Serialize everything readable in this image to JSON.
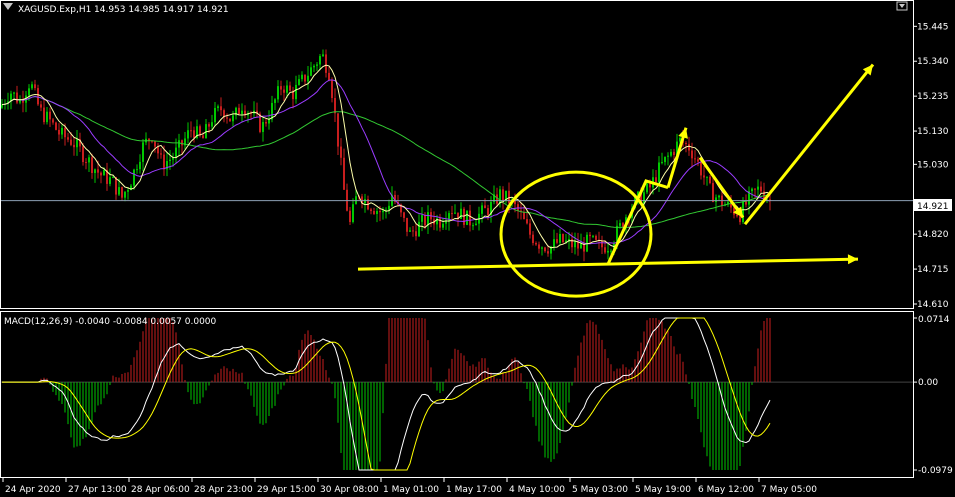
{
  "window": {
    "title": "XAGUSD.Exp,H1",
    "ohlc": "14.953 14.985 14.917 14.921"
  },
  "colors": {
    "background": "#000000",
    "grid_frame": "#ffffff",
    "bull_candle": "#00c800",
    "bear_candle": "#c81e1e",
    "ma_fast": "#ffffaa",
    "ma_mid": "#9a3cff",
    "ma_slow": "#32c832",
    "price_line": "#8da0b4",
    "annotation": "#ffff00",
    "macd_main": "#ffffff",
    "macd_signal": "#ffff00"
  },
  "price_axis": {
    "ticks": [
      "15.445",
      "15.340",
      "15.235",
      "15.130",
      "15.030",
      "14.921",
      "14.820",
      "14.715",
      "14.610"
    ],
    "current": "14.921"
  },
  "macd": {
    "label": "MACD(12,26,9) -0.0040 -0.0084 0.0057 0.0000",
    "ticks": [
      "0.0714",
      "0.00",
      "-0.0979"
    ]
  },
  "time_axis": {
    "ticks": [
      "24 Apr 2020",
      "27 Apr 13:00",
      "28 Apr 06:00",
      "28 Apr 23:00",
      "29 Apr 15:00",
      "30 Apr 08:00",
      "1 May 01:00",
      "1 May 17:00",
      "4 May 10:00",
      "5 May 03:00",
      "5 May 19:00",
      "6 May 12:00",
      "7 May 05:00"
    ]
  },
  "chart_data": [
    {
      "type": "candlestick",
      "symbol": "XAGUSD.Exp",
      "timeframe": "H1",
      "ylim": [
        14.61,
        15.47
      ],
      "indicators": [
        "moving average (fast)",
        "moving average (mid)",
        "moving average (slow)"
      ],
      "annotations": [
        "ellipse around consolidation near 14.78",
        "horizontal support arrow near 14.70",
        "zig-zag projection arrow toward 15.33"
      ],
      "close_path": [
        [
          0,
          15.2
        ],
        [
          10,
          15.25
        ],
        [
          20,
          15.22
        ],
        [
          30,
          15.28
        ],
        [
          40,
          15.19
        ],
        [
          50,
          15.16
        ],
        [
          60,
          15.12
        ],
        [
          72,
          15.1
        ],
        [
          86,
          15.05
        ],
        [
          100,
          15.0
        ],
        [
          112,
          14.98
        ],
        [
          122,
          14.93
        ],
        [
          132,
          14.99
        ],
        [
          142,
          15.08
        ],
        [
          152,
          15.12
        ],
        [
          162,
          15.03
        ],
        [
          172,
          15.05
        ],
        [
          182,
          15.09
        ],
        [
          192,
          15.14
        ],
        [
          202,
          15.1
        ],
        [
          212,
          15.17
        ],
        [
          222,
          15.2
        ],
        [
          232,
          15.16
        ],
        [
          242,
          15.21
        ],
        [
          252,
          15.18
        ],
        [
          262,
          15.14
        ],
        [
          272,
          15.2
        ],
        [
          282,
          15.27
        ],
        [
          292,
          15.24
        ],
        [
          302,
          15.28
        ],
        [
          312,
          15.32
        ],
        [
          322,
          15.36
        ],
        [
          330,
          15.3
        ],
        [
          338,
          15.1
        ],
        [
          344,
          14.95
        ],
        [
          350,
          14.85
        ],
        [
          358,
          14.95
        ],
        [
          366,
          14.92
        ],
        [
          374,
          14.9
        ],
        [
          384,
          14.88
        ],
        [
          392,
          14.94
        ],
        [
          400,
          14.88
        ],
        [
          410,
          14.82
        ],
        [
          420,
          14.85
        ],
        [
          430,
          14.87
        ],
        [
          440,
          14.86
        ],
        [
          450,
          14.9
        ],
        [
          460,
          14.88
        ],
        [
          470,
          14.86
        ],
        [
          480,
          14.88
        ],
        [
          490,
          14.9
        ],
        [
          500,
          14.94
        ],
        [
          510,
          14.92
        ],
        [
          520,
          14.88
        ],
        [
          530,
          14.82
        ],
        [
          540,
          14.79
        ],
        [
          550,
          14.78
        ],
        [
          560,
          14.8
        ],
        [
          570,
          14.79
        ],
        [
          580,
          14.78
        ],
        [
          590,
          14.8
        ],
        [
          600,
          14.78
        ],
        [
          610,
          14.79
        ],
        [
          620,
          14.84
        ],
        [
          630,
          14.9
        ],
        [
          640,
          14.93
        ],
        [
          650,
          14.96
        ],
        [
          660,
          15.02
        ],
        [
          670,
          15.06
        ],
        [
          680,
          15.1
        ],
        [
          690,
          15.08
        ],
        [
          700,
          15.02
        ],
        [
          710,
          14.95
        ],
        [
          720,
          14.92
        ],
        [
          730,
          14.9
        ],
        [
          740,
          14.88
        ],
        [
          750,
          14.93
        ],
        [
          760,
          14.96
        ],
        [
          770,
          14.92
        ]
      ]
    },
    {
      "type": "bar",
      "name": "MACD(12,26,9)",
      "ylim": [
        -0.0979,
        0.0714
      ],
      "values_signal": [
        -0.004,
        -0.0084,
        0.0057,
        0.0
      ]
    }
  ]
}
